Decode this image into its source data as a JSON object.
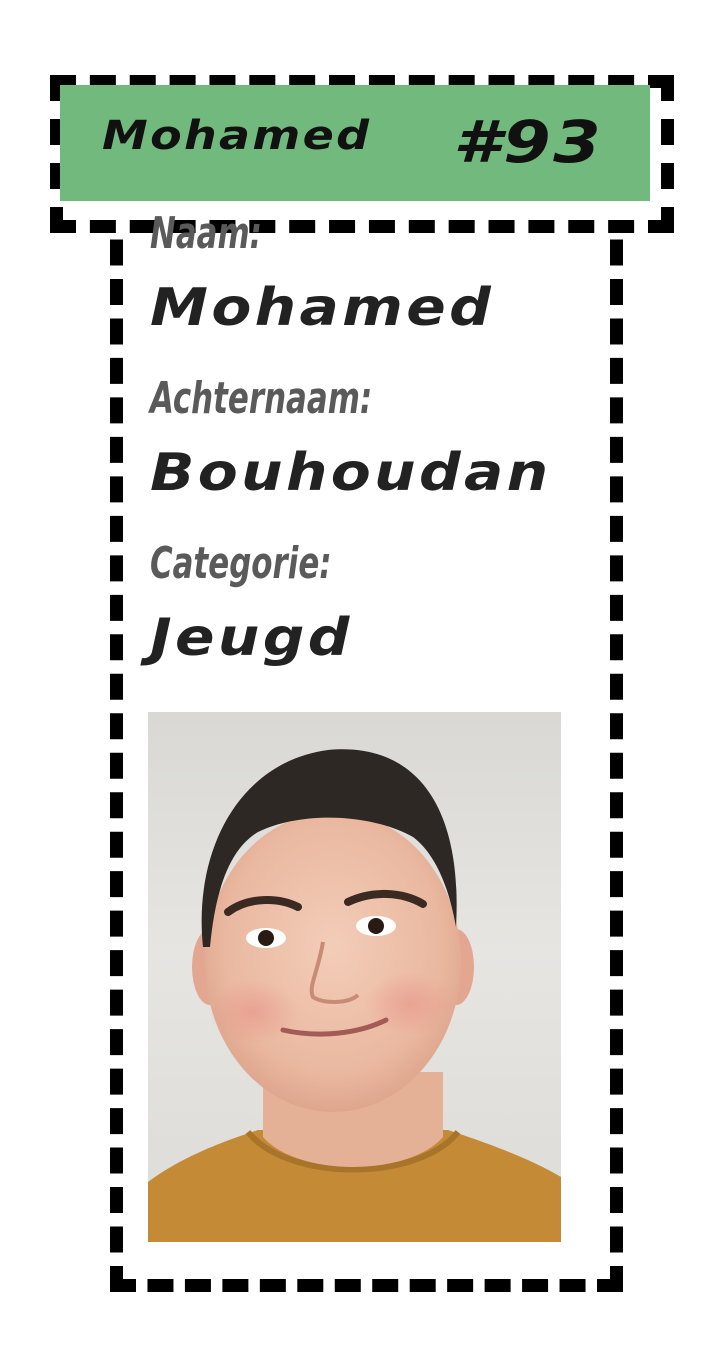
{
  "header": {
    "name": "Mohamed",
    "number": "#93",
    "bar_color": "#71b97c"
  },
  "fields": {
    "first_name_label": "Naam:",
    "first_name_value": "Mohamed",
    "last_name_label": "Achternaam:",
    "last_name_value": "Bouhoudan",
    "category_label": "Categorie:",
    "category_value": "Jeugd"
  },
  "photo": {
    "subject": "portrait photo of a smiling boy in a mustard shirt"
  },
  "colors": {
    "frame": "#000000",
    "label": "#5a5a5a",
    "value": "#222222"
  }
}
